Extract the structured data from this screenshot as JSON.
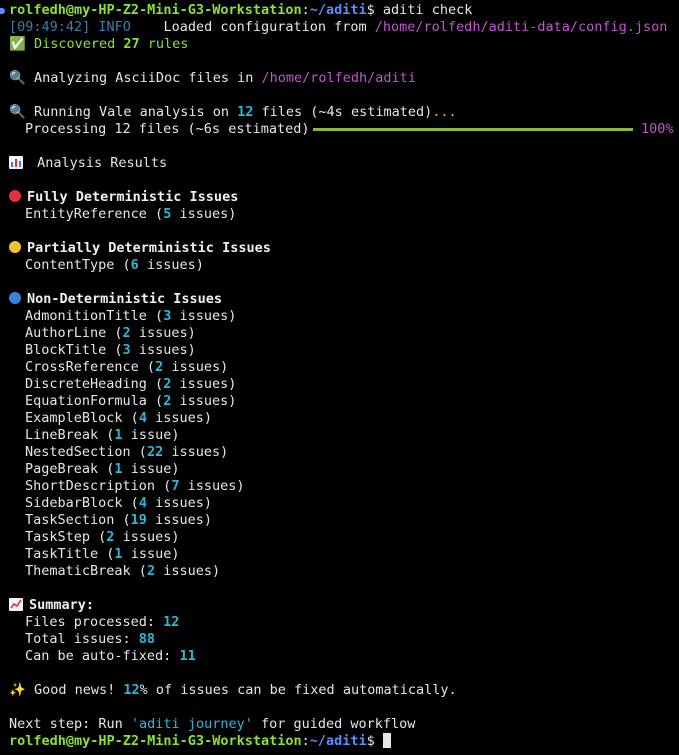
{
  "prompt": {
    "user_host": "rolfedh@my-HP-Z2-Mini-G3-Workstation",
    "separator": ":",
    "cwd": "~/aditi",
    "symbol": "$ ",
    "command": "aditi check"
  },
  "log": {
    "timestamp": "[09:49:42]",
    "level": "INFO",
    "message": "    Loaded configuration from ",
    "config_path": "/home/rolfedh/aditi-data/config.json"
  },
  "discovered": {
    "icon": "✅",
    "prefix": " Discovered ",
    "count": "27",
    "suffix": " rules"
  },
  "analyzing": {
    "icon": "🔍",
    "prefix": " Analyzing AsciiDoc files in ",
    "path": "/home/rolfedh/aditi"
  },
  "running": {
    "icon": "🔍",
    "prefix": " Running Vale analysis on ",
    "count": "12",
    "suffix": " files (~4s estimated)",
    "ellipsis": "..."
  },
  "progress": {
    "label": "Processing 12 files (~6s estimated)",
    "percent_text": "100%",
    "fraction": 1.0,
    "color": "#8cb93a"
  },
  "results_header": {
    "icon": "bar-chart-icon",
    "text": " Analysis Results"
  },
  "sections": {
    "fully": {
      "dot_color": "#e8303a",
      "title": "Fully Deterministic Issues",
      "items": [
        {
          "name": "EntityReference",
          "count": "5",
          "unit": "issues"
        }
      ]
    },
    "partially": {
      "dot_color": "#f2c12e",
      "title": "Partially Deterministic Issues",
      "items": [
        {
          "name": "ContentType",
          "count": "6",
          "unit": "issues"
        }
      ]
    },
    "non": {
      "dot_color": "#3b82e0",
      "title": "Non-Deterministic Issues",
      "items": [
        {
          "name": "AdmonitionTitle",
          "count": "3",
          "unit": "issues"
        },
        {
          "name": "AuthorLine",
          "count": "2",
          "unit": "issues"
        },
        {
          "name": "BlockTitle",
          "count": "3",
          "unit": "issues"
        },
        {
          "name": "CrossReference",
          "count": "2",
          "unit": "issues"
        },
        {
          "name": "DiscreteHeading",
          "count": "2",
          "unit": "issues"
        },
        {
          "name": "EquationFormula",
          "count": "2",
          "unit": "issues"
        },
        {
          "name": "ExampleBlock",
          "count": "4",
          "unit": "issues"
        },
        {
          "name": "LineBreak",
          "count": "1",
          "unit": "issue"
        },
        {
          "name": "NestedSection",
          "count": "22",
          "unit": "issues"
        },
        {
          "name": "PageBreak",
          "count": "1",
          "unit": "issue"
        },
        {
          "name": "ShortDescription",
          "count": "7",
          "unit": "issues"
        },
        {
          "name": "SidebarBlock",
          "count": "4",
          "unit": "issues"
        },
        {
          "name": "TaskSection",
          "count": "19",
          "unit": "issues"
        },
        {
          "name": "TaskStep",
          "count": "2",
          "unit": "issues"
        },
        {
          "name": "TaskTitle",
          "count": "1",
          "unit": "issue"
        },
        {
          "name": "ThematicBreak",
          "count": "2",
          "unit": "issues"
        }
      ]
    }
  },
  "summary": {
    "icon": "chart-increasing-icon",
    "title": "Summary:",
    "files_label": "Files processed: ",
    "files_value": "12",
    "total_label": "Total issues: ",
    "total_value": "88",
    "auto_label": "Can be auto-fixed: ",
    "auto_value": "11"
  },
  "good_news": {
    "icon": "✨",
    "prefix": " Good news! ",
    "percent": "12",
    "suffix": "% of issues can be fixed automatically."
  },
  "next_step": {
    "prefix": "Next step: Run ",
    "command": "'aditi journey'",
    "suffix": " for guided workflow"
  }
}
